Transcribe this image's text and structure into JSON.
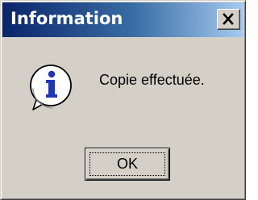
{
  "window": {
    "title": "Information",
    "close_icon": "close-icon"
  },
  "content": {
    "icon": "info-icon",
    "message": "Copie effectuée."
  },
  "buttons": {
    "ok_label": "OK"
  },
  "colors": {
    "face": "#d4d0c8",
    "title_start": "#0a246a",
    "title_end": "#a6caf0",
    "info_blue": "#1f37b5"
  }
}
